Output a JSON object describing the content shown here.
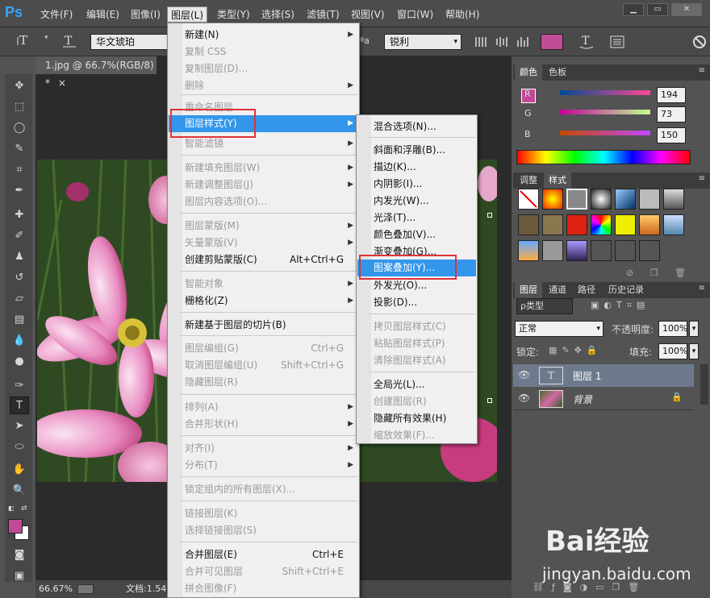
{
  "menubar": {
    "logo": "Ps",
    "items": [
      "文件(F)",
      "编辑(E)",
      "图像(I)",
      "图层(L)",
      "类型(Y)",
      "选择(S)",
      "滤镜(T)",
      "视图(V)",
      "窗口(W)",
      "帮助(H)"
    ],
    "window_buttons": [
      "▁",
      "▭",
      "✕"
    ]
  },
  "options": {
    "font_family": "华文琥珀",
    "aa_prefix": "ªa",
    "antialias": "锐利",
    "text_color": "#c24d96"
  },
  "document": {
    "tab_title": "1.jpg @ 66.7%(RGB/8) *",
    "close": "×",
    "zoom": "66.67%",
    "doc_info": "文档:1.54"
  },
  "layer_menu": {
    "items": [
      {
        "label": "新建(N)",
        "enabled": true,
        "submenu": true
      },
      {
        "label": "复制 CSS",
        "enabled": false
      },
      {
        "label": "复制图层(D)...",
        "enabled": false
      },
      {
        "label": "删除",
        "enabled": false,
        "submenu": true
      },
      {
        "label": "重命名图层...",
        "enabled": false
      },
      {
        "label": "图层样式(Y)",
        "enabled": true,
        "submenu": true,
        "highlighted": true
      },
      {
        "label": "智能滤镜",
        "enabled": false,
        "submenu": true
      },
      {
        "label": "新建填充图层(W)",
        "enabled": false,
        "submenu": true
      },
      {
        "label": "新建调整图层(J)",
        "enabled": false,
        "submenu": true
      },
      {
        "label": "图层内容选项(O)...",
        "enabled": false
      },
      {
        "label": "图层蒙版(M)",
        "enabled": false,
        "submenu": true
      },
      {
        "label": "矢量蒙版(V)",
        "enabled": false,
        "submenu": true
      },
      {
        "label": "创建剪贴蒙版(C)",
        "enabled": true,
        "shortcut": "Alt+Ctrl+G"
      },
      {
        "label": "智能对象",
        "enabled": false,
        "submenu": true
      },
      {
        "label": "栅格化(Z)",
        "enabled": true,
        "submenu": true
      },
      {
        "label": "新建基于图层的切片(B)",
        "enabled": true
      },
      {
        "label": "图层编组(G)",
        "enabled": false,
        "shortcut": "Ctrl+G"
      },
      {
        "label": "取消图层编组(U)",
        "enabled": false,
        "shortcut": "Shift+Ctrl+G"
      },
      {
        "label": "隐藏图层(R)",
        "enabled": false
      },
      {
        "label": "排列(A)",
        "enabled": false,
        "submenu": true
      },
      {
        "label": "合并形状(H)",
        "enabled": false,
        "submenu": true
      },
      {
        "label": "对齐(I)",
        "enabled": false,
        "submenu": true
      },
      {
        "label": "分布(T)",
        "enabled": false,
        "submenu": true
      },
      {
        "label": "锁定组内的所有图层(X)...",
        "enabled": false
      },
      {
        "label": "链接图层(K)",
        "enabled": false
      },
      {
        "label": "选择链接图层(S)",
        "enabled": false
      },
      {
        "label": "合并图层(E)",
        "enabled": true,
        "shortcut": "Ctrl+E"
      },
      {
        "label": "合并可见图层",
        "enabled": false,
        "shortcut": "Shift+Ctrl+E"
      },
      {
        "label": "拼合图像(F)",
        "enabled": false
      }
    ]
  },
  "style_submenu": {
    "items": [
      {
        "label": "混合选项(N)...",
        "enabled": true
      },
      {
        "label": "斜面和浮雕(B)...",
        "enabled": true
      },
      {
        "label": "描边(K)...",
        "enabled": true
      },
      {
        "label": "内阴影(I)...",
        "enabled": true
      },
      {
        "label": "内发光(W)...",
        "enabled": true
      },
      {
        "label": "光泽(T)...",
        "enabled": true
      },
      {
        "label": "颜色叠加(V)...",
        "enabled": true
      },
      {
        "label": "渐变叠加(G)...",
        "enabled": true
      },
      {
        "label": "图案叠加(Y)...",
        "enabled": true,
        "highlighted": true
      },
      {
        "label": "外发光(O)...",
        "enabled": true
      },
      {
        "label": "投影(D)...",
        "enabled": true
      },
      {
        "label": "拷贝图层样式(C)",
        "enabled": false
      },
      {
        "label": "粘贴图层样式(P)",
        "enabled": false
      },
      {
        "label": "清除图层样式(A)",
        "enabled": false
      },
      {
        "label": "全局光(L)...",
        "enabled": true
      },
      {
        "label": "创建图层(R)",
        "enabled": false
      },
      {
        "label": "隐藏所有效果(H)",
        "enabled": true
      },
      {
        "label": "缩放效果(F)...",
        "enabled": false
      }
    ]
  },
  "color_panel": {
    "tabs": [
      "颜色",
      "色板"
    ],
    "channels": [
      {
        "label": "R",
        "value": "194"
      },
      {
        "label": "G",
        "value": "73"
      },
      {
        "label": "B",
        "value": "150"
      }
    ],
    "foreground": "#c24996"
  },
  "styles_panel": {
    "tabs": [
      "调整",
      "样式"
    ]
  },
  "layers_panel": {
    "tabs": [
      "图层",
      "通道",
      "路径",
      "历史记录"
    ],
    "filter": "ρ类型",
    "blend_mode": "正常",
    "opacity_label": "不透明度:",
    "opacity": "100%",
    "lock_label": "锁定:",
    "fill_label": "填充:",
    "fill": "100%",
    "layers": [
      {
        "name": "图层 1",
        "type": "text",
        "selected": true
      },
      {
        "name": "背景",
        "type": "image",
        "locked": true
      }
    ]
  },
  "watermark": {
    "brand": "Bai经验",
    "url": "jingyan.baidu.com"
  }
}
